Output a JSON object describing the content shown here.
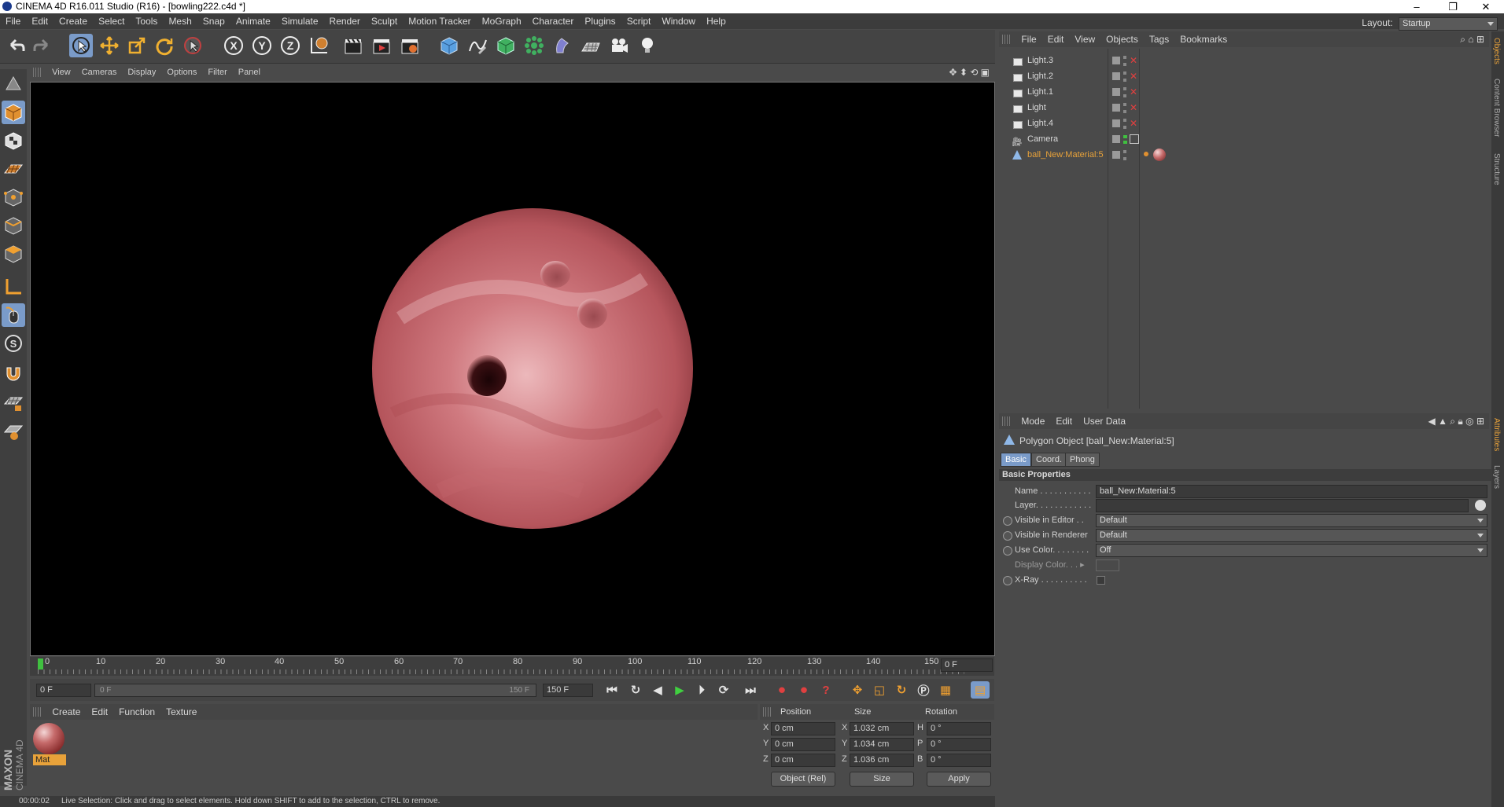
{
  "window": {
    "title": "CINEMA 4D R16.011 Studio (R16) - [bowling222.c4d *]",
    "controls": [
      "–",
      "❐",
      "✕"
    ]
  },
  "menubar": {
    "items": [
      "File",
      "Edit",
      "Create",
      "Select",
      "Tools",
      "Mesh",
      "Snap",
      "Animate",
      "Simulate",
      "Render",
      "Sculpt",
      "Motion Tracker",
      "MoGraph",
      "Character",
      "Plugins",
      "Script",
      "Window",
      "Help"
    ],
    "layout_label": "Layout:",
    "layout_value": "Startup"
  },
  "toolbar_axes": [
    "X",
    "Y",
    "Z"
  ],
  "viewport": {
    "menu": [
      "View",
      "Cameras",
      "Display",
      "Options",
      "Filter",
      "Panel"
    ]
  },
  "timeline": {
    "ticks": [
      "0",
      "10",
      "20",
      "30",
      "40",
      "50",
      "60",
      "70",
      "80",
      "90",
      "100",
      "110",
      "120",
      "130",
      "140",
      "150"
    ],
    "current_frame_field": "0 F",
    "start_field": "0 F",
    "range_start": "0 F",
    "range_end": "150 F",
    "end_field": "150 F",
    "current_marker_frame": 0
  },
  "material_manager": {
    "menu": [
      "Create",
      "Edit",
      "Function",
      "Texture"
    ],
    "materials": [
      {
        "name": "Mat"
      }
    ]
  },
  "coordinates": {
    "headers": [
      "Position",
      "Size",
      "Rotation"
    ],
    "rows": [
      {
        "axis": "X",
        "pos": "0 cm",
        "size_axis": "X",
        "size": "1.032 cm",
        "rot_axis": "H",
        "rot": "0 °"
      },
      {
        "axis": "Y",
        "pos": "0 cm",
        "size_axis": "Y",
        "size": "1.034 cm",
        "rot_axis": "P",
        "rot": "0 °"
      },
      {
        "axis": "Z",
        "pos": "0 cm",
        "size_axis": "Z",
        "size": "1.036 cm",
        "rot_axis": "B",
        "rot": "0 °"
      }
    ],
    "mode_select": "Object (Rel)",
    "size_select": "Size",
    "apply_label": "Apply"
  },
  "statusbar": {
    "time": "00:00:02",
    "message": "Live Selection: Click and drag to select elements. Hold down SHIFT to add to the selection, CTRL to remove."
  },
  "object_manager": {
    "menu": [
      "File",
      "Edit",
      "View",
      "Objects",
      "Tags",
      "Bookmarks"
    ],
    "objects": [
      {
        "name": "Light.3",
        "kind": "light",
        "selected": false
      },
      {
        "name": "Light.2",
        "kind": "light",
        "selected": false
      },
      {
        "name": "Light.1",
        "kind": "light",
        "selected": false
      },
      {
        "name": "Light",
        "kind": "light",
        "selected": false
      },
      {
        "name": "Light.4",
        "kind": "light",
        "selected": false
      },
      {
        "name": "Camera",
        "kind": "camera",
        "selected": false
      },
      {
        "name": "ball_New:Material:5",
        "kind": "polygon",
        "selected": true
      }
    ]
  },
  "right_tabs": [
    "Objects",
    "Content Browser",
    "Structure",
    "Attributes",
    "Layers"
  ],
  "attributes": {
    "menu": [
      "Mode",
      "Edit",
      "User Data"
    ],
    "object_title": "Polygon Object [ball_New:Material:5]",
    "tabs": [
      "Basic",
      "Coord.",
      "Phong"
    ],
    "active_tab": "Basic",
    "section": "Basic Properties",
    "fields": [
      {
        "label": "Name . . . . . . . . . . .",
        "value": "ball_New:Material:5",
        "type": "text",
        "radio": false
      },
      {
        "label": "Layer. . . . . . . . . . . .",
        "value": "",
        "type": "text",
        "radio": false
      },
      {
        "label": "Visible in Editor . .",
        "value": "Default",
        "type": "combo",
        "radio": true
      },
      {
        "label": "Visible in Renderer",
        "value": "Default",
        "type": "combo",
        "radio": true
      },
      {
        "label": "Use Color. . . . . . . .",
        "value": "Off",
        "type": "combo",
        "radio": true
      },
      {
        "label": "Display Color. . . ▸",
        "value": "",
        "type": "swatch",
        "radio": false
      },
      {
        "label": "X-Ray . . . . . . . . . .",
        "value": "",
        "type": "checkbox",
        "radio": true
      }
    ]
  },
  "brand": {
    "line1": "MAXON",
    "line2": "CINEMA 4D"
  },
  "colors": {
    "accent": "#7a9bc9",
    "selection": "#e8a23a",
    "ball": "#c86a6e"
  }
}
